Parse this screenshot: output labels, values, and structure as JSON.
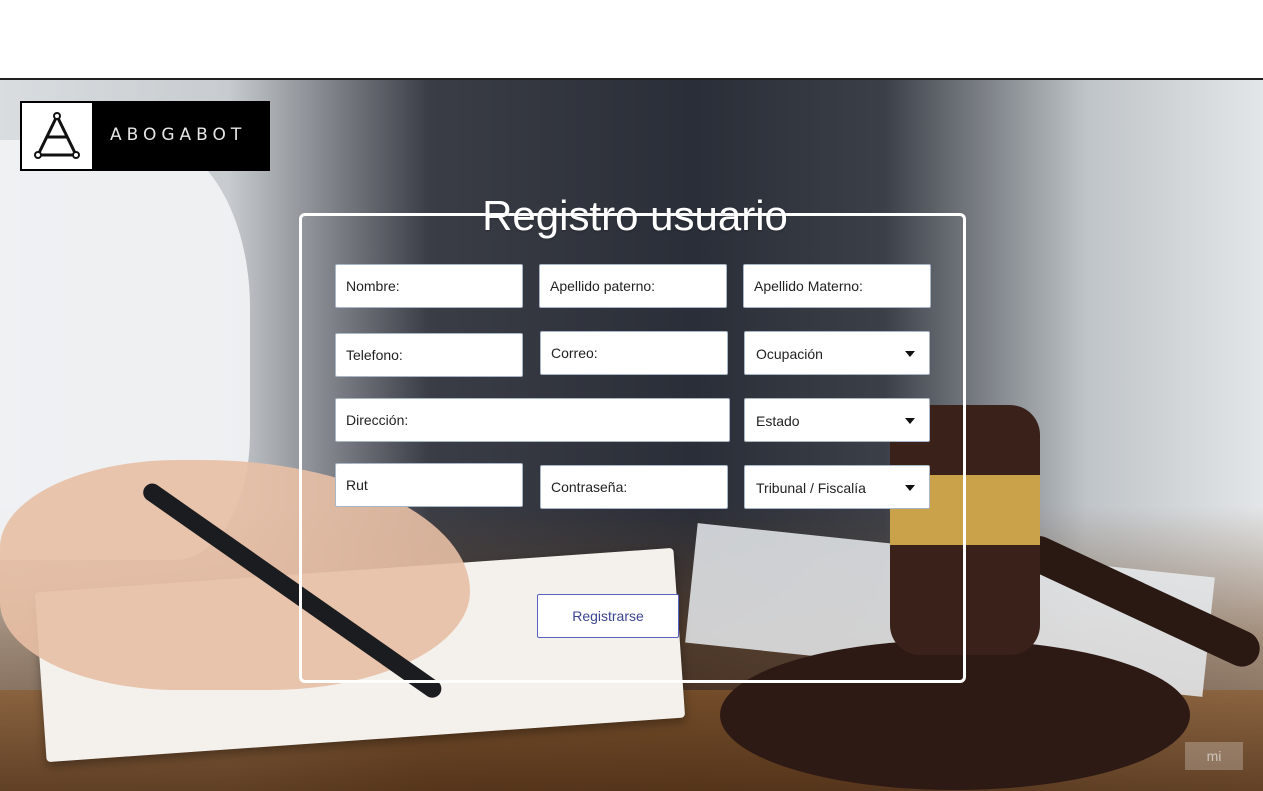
{
  "brand": {
    "name": "ABOGABOT"
  },
  "form": {
    "title": "Registro usuario",
    "fields": {
      "nombre": "Nombre:",
      "apellido_paterno": "Apellido paterno:",
      "apellido_materno": "Apellido Materno:",
      "telefono": "Telefono:",
      "correo": "Correo:",
      "direccion": "Dirección:",
      "rut": "Rut",
      "contrasena": "Contraseña:"
    },
    "selects": {
      "ocupacion": "Ocupación",
      "estado": "Estado",
      "tribunal": "Tribunal / Fiscalía"
    },
    "submit_label": "Registrarse"
  },
  "watermark": {
    "text": "mi"
  },
  "colors": {
    "form_border": "#ffffff",
    "button_border": "#5a63c2",
    "button_text": "#3c4592",
    "field_border": "#a9b6c7"
  },
  "icons": {
    "select_caret": "caret-down-icon",
    "logo": "abogabot-logo-icon"
  }
}
